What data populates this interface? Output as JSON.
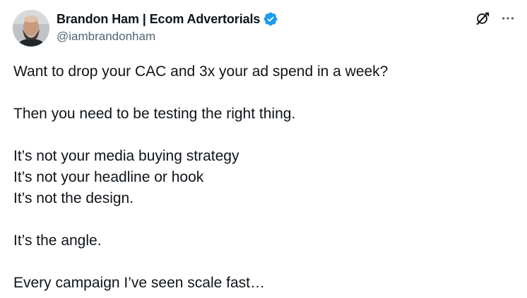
{
  "author": {
    "display_name": "Brandon Ham | Ecom Advertorials",
    "handle": "@iambrandonham",
    "verified": true
  },
  "icons": {
    "verified": "verified-badge-icon",
    "grok": "grok-icon",
    "more": "more-options-icon"
  },
  "colors": {
    "verified_blue": "#1d9bf0",
    "text_primary": "#0f1419",
    "text_secondary": "#536471"
  },
  "tweet": {
    "lines": [
      "Want to drop your CAC and 3x your ad spend in a week?",
      "",
      "Then you need to be testing the right thing.",
      "",
      "It’s not your media buying strategy",
      "It’s not your headline or hook",
      "It’s not the design.",
      "",
      "It’s the angle.",
      "",
      "Every campaign I’ve seen scale fast…"
    ]
  }
}
